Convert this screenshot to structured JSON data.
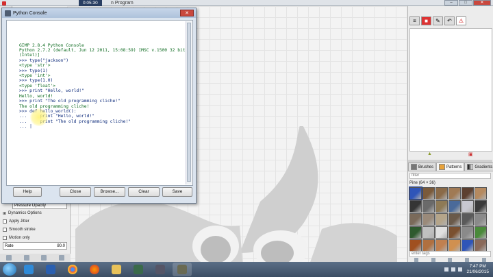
{
  "recording": {
    "time": "0:05:30",
    "title_fragment": "n Program"
  },
  "console": {
    "title": "Python Console",
    "lines": [
      {
        "text": "GIMP 2.8.4 Python Console",
        "kind": "out"
      },
      {
        "text": "Python 2.7.2 (default, Jun 12 2011, 15:08:59) [MSC v.1500 32 bit",
        "kind": "out"
      },
      {
        "text": "(Intel)]",
        "kind": "out"
      },
      {
        "text": ">>> type(\"jackson\")",
        "kind": "in"
      },
      {
        "text": "<type 'str'>",
        "kind": "out"
      },
      {
        "text": ">>> type(1)",
        "kind": "in"
      },
      {
        "text": "<type 'int'>",
        "kind": "out"
      },
      {
        "text": ">>> type(1.0)",
        "kind": "in"
      },
      {
        "text": "<type 'float'>",
        "kind": "out"
      },
      {
        "text": ">>> print \"Hello, world!\"",
        "kind": "in"
      },
      {
        "text": "Hello, world!",
        "kind": "out"
      },
      {
        "text": ">>> print \"The old programming cliche!\"",
        "kind": "in"
      },
      {
        "text": "The old programming cliche!",
        "kind": "out"
      },
      {
        "text": ">>> def hello_world():",
        "kind": "in"
      },
      {
        "text": "...     print \"Hello, world!\"",
        "kind": "in"
      },
      {
        "text": "...     print \"The old programming cliche!\"",
        "kind": "in"
      },
      {
        "text": "... |",
        "kind": "in"
      }
    ],
    "buttons": {
      "help": "Help",
      "close": "Close",
      "browse": "Browse...",
      "clear": "Clear",
      "save": "Save"
    }
  },
  "tool_options": {
    "dynamics_value": "Pressure Opacity",
    "dynamics_options": "Dynamics Options",
    "apply_jitter": "Apply Jitter",
    "smooth_stroke": "Smooth stroke",
    "motion_only": "Motion only",
    "rate_label": "Rate",
    "rate_value": "80.0"
  },
  "dock": {
    "tabs": {
      "brushes": "Brushes",
      "patterns": "Patterns",
      "gradients": "Gradients"
    },
    "filter_placeholder": "filter",
    "pattern_name": "Pine (64 × 36)",
    "tag_placeholder": "enter tags",
    "pattern_colors": [
      "#2f55b8",
      "#7a5a3a",
      "#8a6a48",
      "#a07a55",
      "#5c4030",
      "#b58a60",
      "#353535",
      "#6a6a6a",
      "#8e7a56",
      "#4a6a9a",
      "#c8c8d0",
      "#3a3a3a",
      "#7a6a5a",
      "#9a8a7a",
      "#b5a58a",
      "#6a5a4a",
      "#5a5a5a",
      "#8a8a8a",
      "#2e5a2e",
      "#c0c0c0",
      "#e0e0e0",
      "#7a5030",
      "#8a8a8a",
      "#4a8a3a",
      "#a05020",
      "#b07040",
      "#c08050",
      "#d09050",
      "#2f55b8",
      "#8a6a5a"
    ]
  },
  "taskbar": {
    "time": "7:47 PM",
    "date": "21/06/2015"
  },
  "colors": {
    "accent": "#2a3f62",
    "close_red": "#c9483e"
  }
}
